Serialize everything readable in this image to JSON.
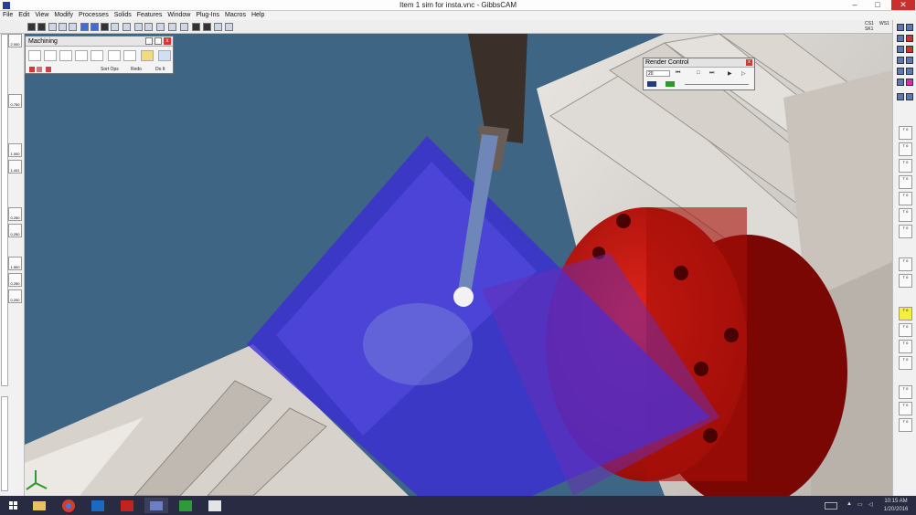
{
  "window": {
    "title": "Item 1 sim for insta.vnc - GibbsCAM",
    "min": "–",
    "max": "□",
    "close": "✕"
  },
  "menu": [
    "File",
    "Edit",
    "View",
    "Modify",
    "Processes",
    "Solids",
    "Features",
    "Window",
    "Plug-Ins",
    "Macros",
    "Help"
  ],
  "coords": {
    "line1": "CS1",
    "line2": "SK1",
    "line3": "WS1"
  },
  "left_tools": {
    "top_label": "2.000",
    "labels": [
      "0.750",
      "1.000",
      "1.441",
      "0.250",
      "0.250",
      "1.500",
      "0.250",
      "0.200"
    ]
  },
  "right_tools": {
    "label": "T 0",
    "count": 16,
    "selected_index": 10
  },
  "machining": {
    "title": "Machining",
    "buttons": [
      "Sort Ops",
      "Redo",
      "Do It"
    ],
    "icon_names": [
      "drill-icon",
      "contour-icon",
      "pocket-icon",
      "face-icon",
      "thread-icon",
      "solid-surface-icon",
      "rotary-icon",
      "mill-icon",
      "vise-icon"
    ]
  },
  "render_control": {
    "title": "Render Control",
    "speed": "20",
    "controls": [
      "⏮",
      "□",
      "⏭",
      "▶",
      "▷"
    ]
  },
  "nav_icons": [
    "rotate-icon",
    "zoom-icon",
    "home-icon",
    "pan-icon",
    "hand-icon"
  ],
  "taskbar": {
    "apps": [
      "start-button",
      "file-explorer-icon",
      "chrome-icon",
      "outlook-icon",
      "app-red-icon",
      "gibbscam-icon",
      "camtasia-icon",
      "camtasia-recorder-icon"
    ],
    "active_index": 5,
    "time": "10:15 AM",
    "date": "1/20/2016"
  },
  "colors": {
    "viewport_bg": "#3f6584",
    "part_blue": "#3a2bd8",
    "fixture_red": "#c8140c",
    "machine_gray": "#cfcac4"
  }
}
